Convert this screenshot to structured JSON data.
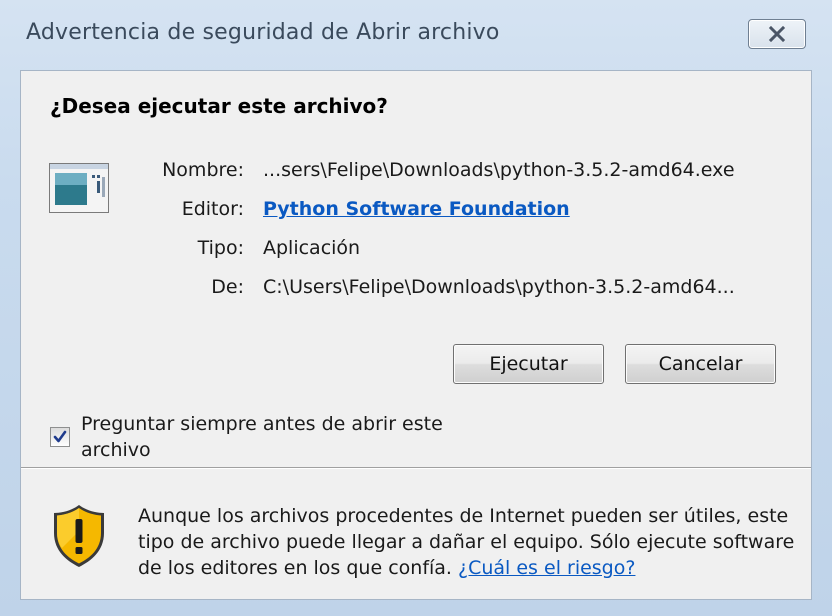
{
  "window": {
    "title": "Advertencia de seguridad de Abrir archivo"
  },
  "dialog": {
    "question": "¿Desea ejecutar este archivo?",
    "fields": {
      "name_label": "Nombre:",
      "name_value": "...sers\\Felipe\\Downloads\\python-3.5.2-amd64.exe",
      "publisher_label": "Editor:",
      "publisher_value": "Python Software Foundation",
      "type_label": "Tipo:",
      "type_value": "Aplicación",
      "from_label": "De:",
      "from_value": "C:\\Users\\Felipe\\Downloads\\python-3.5.2-amd64..."
    },
    "buttons": {
      "run": "Ejecutar",
      "cancel": "Cancelar"
    },
    "checkbox": {
      "label": "Preguntar siempre antes de abrir este archivo",
      "checked": true
    },
    "warning": {
      "text": "Aunque los archivos procedentes de Internet pueden ser útiles, este tipo de archivo puede llegar a dañar el equipo. Sólo ejecute software de los editores en los que confía.",
      "link": "¿Cuál es el riesgo?"
    }
  },
  "icons": {
    "close": "close-icon",
    "file": "application-file-icon",
    "shield": "warning-shield-icon",
    "check": "checkmark-icon"
  },
  "colors": {
    "link": "#0a59c2",
    "frame": "#c9dbee",
    "content_bg": "#f0f0f0",
    "shield_yellow": "#f5b800"
  }
}
